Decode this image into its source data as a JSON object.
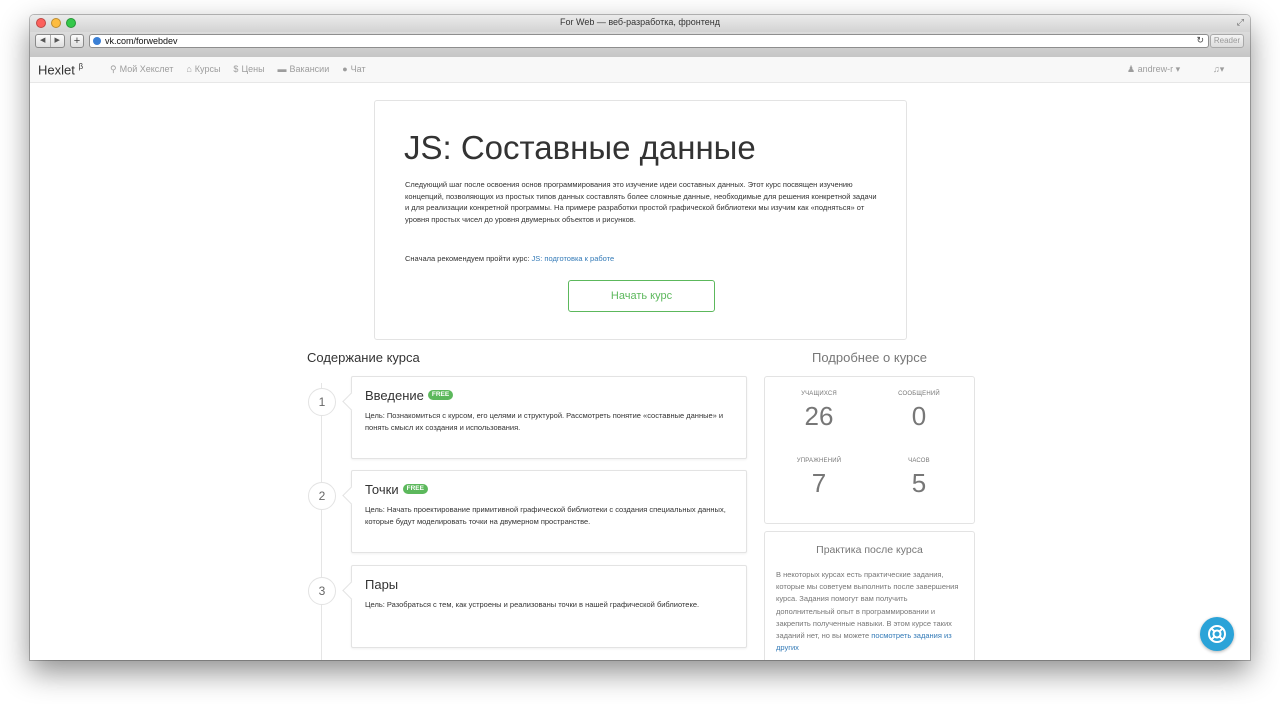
{
  "window": {
    "title": "For Web — веб-разработка, фронтенд",
    "url": "vk.com/forwebdev",
    "reader_label": "Reader"
  },
  "site_nav": {
    "brand": "Hexlet",
    "brand_sup": "β",
    "items": [
      {
        "label": "Мой Хекслет",
        "icon": "map-marker-icon"
      },
      {
        "label": "Курсы",
        "icon": "university-icon"
      },
      {
        "label": "Цены",
        "icon": "dollar-icon"
      },
      {
        "label": "Вакансии",
        "icon": "briefcase-icon"
      },
      {
        "label": "Чат",
        "icon": "chat-bubble-icon"
      }
    ],
    "user": "andrew-r"
  },
  "hero": {
    "title": "JS: Составные данные",
    "description": "Следующий шаг после освоения основ программирования это изучение идеи составных данных. Этот курс посвящен изучению концепций, позволяющих из простых типов данных составлять более сложные данные, необходимые для решения конкретной задачи и для реализации конкретной программы. На примере разработки простой графической библиотеки мы изучим как «подняться» от уровня простых чисел до уровня двумерных объектов и рисунков.",
    "recommend_prefix": "Сначала рекомендуем пройти курс:",
    "recommend_link": "JS: подготовка к работе",
    "start_button": "Начать курс"
  },
  "contents": {
    "title": "Содержание курса",
    "lessons": [
      {
        "number": "1",
        "title": "Введение",
        "badge": "FREE",
        "goal": "Цель: Познакомиться с курсом, его целями и структурой. Рассмотреть понятие «составные данные» и понять смысл их создания и использования."
      },
      {
        "number": "2",
        "title": "Точки",
        "badge": "FREE",
        "goal": "Цель: Начать проектирование примитивной графической библиотеки с создания специальных данных, которые будут моделировать точки на двумерном пространстве."
      },
      {
        "number": "3",
        "title": "Пары",
        "badge": "",
        "goal": "Цель: Разобраться с тем, как устроены и реализованы точки в нашей графической библиотеке."
      }
    ]
  },
  "more": {
    "title": "Подробнее о курсе",
    "stats": {
      "students_label": "УЧАЩИХСЯ",
      "students": "26",
      "messages_label": "СООБЩЕНИЙ",
      "messages": "0",
      "exercises_label": "УПРАЖНЕНИЙ",
      "exercises": "7",
      "hours_label": "ЧАСОВ",
      "hours": "5"
    },
    "practice_title": "Практика после курса",
    "practice_text": "В некоторых курсах есть практические задания, которые мы советуем выполнить после завершения курса. Задания помогут вам получить дополнительный опыт в программировании и закрепить полученные навыки. В этом курсе таких заданий нет, но вы можете",
    "practice_link": "посмотреть задания из других"
  },
  "colors": {
    "accent_green": "#5cb85c",
    "link_blue": "#337ab7",
    "help_blue": "#2ba3d8"
  }
}
